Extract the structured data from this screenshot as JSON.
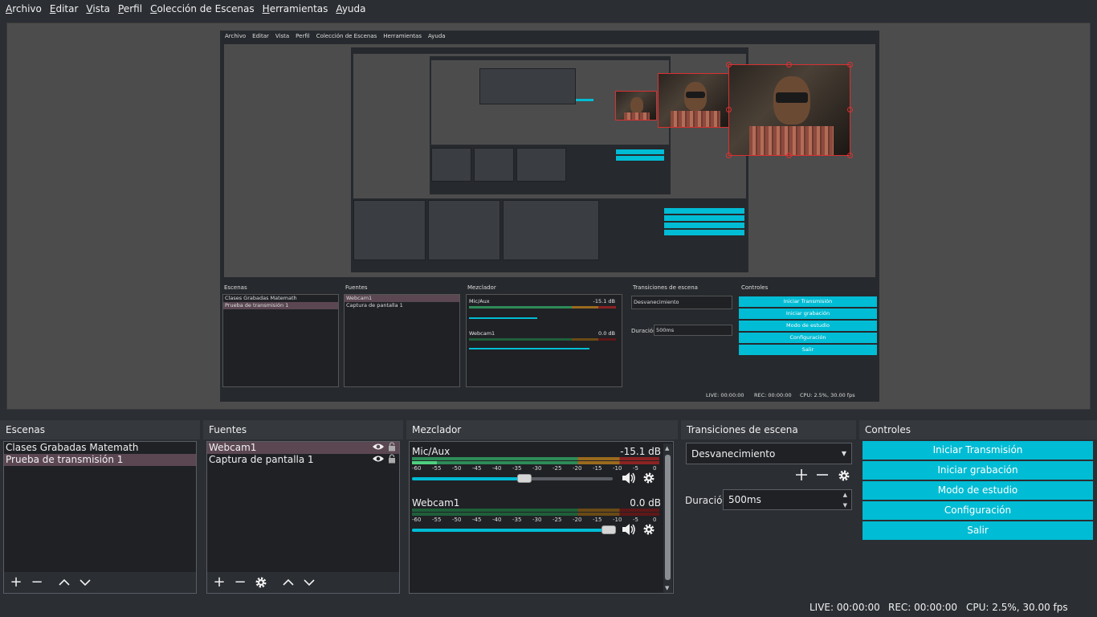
{
  "menu": [
    {
      "label": "Archivo",
      "underline": "A",
      "rest": "rchivo"
    },
    {
      "label": "Editar",
      "underline": "E",
      "rest": "ditar"
    },
    {
      "label": "Vista",
      "underline": "V",
      "rest": "ista"
    },
    {
      "label": "Perfil",
      "underline": "P",
      "rest": "erfil"
    },
    {
      "label": "Colección de Escenas",
      "underline": "C",
      "rest": "olección de Escenas"
    },
    {
      "label": "Herramientas",
      "underline": "H",
      "rest": "erramientas"
    },
    {
      "label": "Ayuda",
      "underline": "A",
      "rest": "yuda"
    }
  ],
  "docks": {
    "scenes": {
      "title": "Escenas",
      "items": [
        "Clases Grabadas Matemath",
        "Prueba de transmisión 1"
      ],
      "selected_index": 1
    },
    "sources": {
      "title": "Fuentes",
      "items": [
        "Webcam1",
        "Captura de pantalla 1"
      ],
      "selected_index": 0
    },
    "mixer": {
      "title": "Mezclador",
      "channels": [
        {
          "name": "Mic/Aux",
          "db": "-15.1 dB",
          "volume": 0.5
        },
        {
          "name": "Webcam1",
          "db": "0.0 dB",
          "volume": 1.0
        }
      ],
      "ticks": [
        "-60",
        "-55",
        "-50",
        "-45",
        "-40",
        "-35",
        "-30",
        "-25",
        "-20",
        "-15",
        "-10",
        "-5",
        "0"
      ]
    },
    "transitions": {
      "title": "Transiciones de escena",
      "selected": "Desvanecimiento",
      "duration_label": "Duración",
      "duration_value": "500ms"
    },
    "controls": {
      "title": "Controles",
      "buttons": [
        "Iniciar Transmisión",
        "Iniciar grabación",
        "Modo de estudio",
        "Configuración",
        "Salir"
      ]
    }
  },
  "status": {
    "live": "LIVE: 00:00:00",
    "rec": "REC: 00:00:00",
    "cpu": "CPU: 2.5%, 30.00 fps"
  },
  "colors": {
    "accent": "#00bcd4",
    "selection": "#5b4752",
    "panel_bg": "#2b2e33",
    "preview_bg": "#4c4c4c"
  }
}
